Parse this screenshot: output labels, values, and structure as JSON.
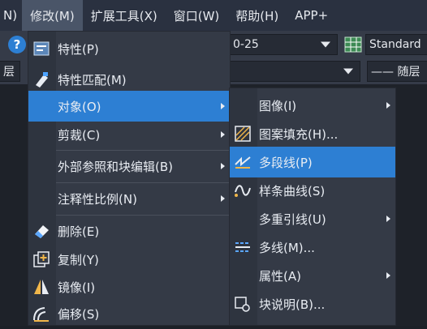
{
  "menubar": {
    "items": [
      {
        "label": "N)"
      },
      {
        "label": "修改(M)"
      },
      {
        "label": "扩展工具(X)"
      },
      {
        "label": "窗口(W)"
      },
      {
        "label": "帮助(H)"
      },
      {
        "label": "APP+"
      }
    ]
  },
  "toolbar": {
    "linetype_value": "0-25",
    "style_value": "Standard",
    "layer_left": "层",
    "layer_right": "—— 随层"
  },
  "modify_menu": {
    "items": [
      {
        "label": "特性(P)",
        "icon": "properties-icon"
      },
      {
        "label": "特性匹配(M)",
        "icon": "match-properties-icon"
      },
      {
        "label": "对象(O)",
        "has_submenu": true,
        "highlighted": true
      },
      {
        "label": "剪裁(C)",
        "has_submenu": true
      },
      {
        "label": "外部参照和块编辑(B)",
        "has_submenu": true
      },
      {
        "label": "注释性比例(N)",
        "has_submenu": true
      },
      {
        "label": "删除(E)",
        "icon": "erase-icon"
      },
      {
        "label": "复制(Y)",
        "icon": "copy-icon"
      },
      {
        "label": "镜像(I)",
        "icon": "mirror-icon"
      },
      {
        "label": "偏移(S)",
        "icon": "offset-icon"
      }
    ]
  },
  "object_submenu": {
    "items": [
      {
        "label": "图像(I)",
        "has_submenu": true
      },
      {
        "label": "图案填充(H)...",
        "icon": "hatch-icon"
      },
      {
        "label": "多段线(P)",
        "icon": "polyline-icon",
        "highlighted": true
      },
      {
        "label": "样条曲线(S)",
        "icon": "spline-icon"
      },
      {
        "label": "多重引线(U)",
        "has_submenu": true
      },
      {
        "label": "多线(M)...",
        "icon": "multiline-icon"
      },
      {
        "label": "属性(A)",
        "has_submenu": true
      },
      {
        "label": "块说明(B)...",
        "icon": "block-description-icon"
      }
    ]
  },
  "colors": {
    "highlight": "#2d7fd3",
    "menu_bg": "#343a46",
    "menubar_bg": "#2a3140"
  }
}
